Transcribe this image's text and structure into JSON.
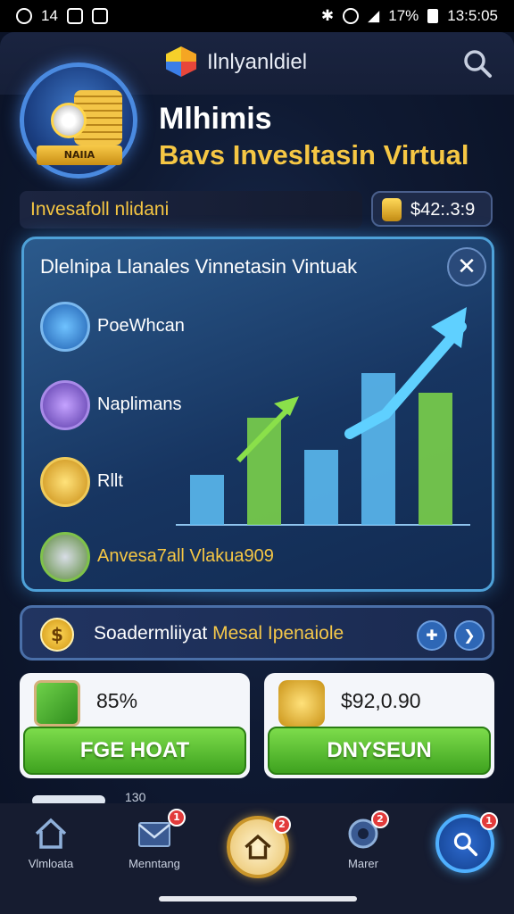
{
  "status_bar": {
    "left_number": "14",
    "battery": "17%",
    "time": "13:5:05"
  },
  "header": {
    "app_title": "Ilnlyanldiel"
  },
  "hero": {
    "badge_text": "NAIIA",
    "title": "Mlhimis",
    "subtitle": "Bavs Invesltasin Virtual"
  },
  "info_bar": {
    "label": "Invesafoll nlidani",
    "balance": "$42:.3:9"
  },
  "panel": {
    "title": "Dlelnipa Llanales Vinnetasin Vintuak",
    "close_glyph": "✕",
    "items": [
      {
        "label": "PoeWhcan"
      },
      {
        "label": "Naplimans"
      },
      {
        "label": "Rllt"
      },
      {
        "label": "Anvesa7all Vlakua909"
      }
    ]
  },
  "chart_data": {
    "type": "bar",
    "values": [
      28,
      60,
      42,
      85,
      74
    ],
    "trend": "up"
  },
  "promo": {
    "coin_glyph": "$",
    "text_plain": "Soadermliiyat",
    "text_highlight": "Mesal Ipenaiole"
  },
  "cards": {
    "left": {
      "value": "85%",
      "button": "FGE HOAT"
    },
    "right": {
      "value": "$92,0.90",
      "button": "DNYSEUN"
    }
  },
  "peek_row": {
    "text": "130"
  },
  "nav": {
    "items": [
      {
        "label": "Vlmloata",
        "badge": ""
      },
      {
        "label": "Menntang",
        "badge": "1"
      },
      {
        "label": "",
        "badge": "2"
      },
      {
        "label": "Marer",
        "badge": "2"
      },
      {
        "label": "",
        "badge": "1"
      }
    ]
  },
  "colors": {
    "accent_gold": "#f6c744",
    "accent_green": "#5cc433",
    "panel_border": "#4ea1d8",
    "badge_red": "#e23b3b"
  }
}
